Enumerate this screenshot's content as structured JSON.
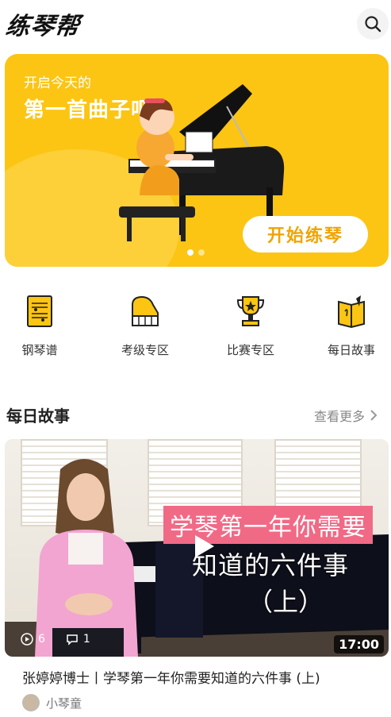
{
  "app": {
    "logo_text": "练琴帮"
  },
  "banner": {
    "subtitle": "开启今天的",
    "title": "第一首曲子吧",
    "cta_label": "开始练琴",
    "dot_count": 2,
    "active_dot": 0,
    "bg_color": "#fcc513"
  },
  "quick_nav": [
    {
      "label": "钢琴谱",
      "icon": "sheet-music-icon"
    },
    {
      "label": "考级专区",
      "icon": "piano-keys-icon"
    },
    {
      "label": "比赛专区",
      "icon": "trophy-icon"
    },
    {
      "label": "每日故事",
      "icon": "story-book-icon"
    }
  ],
  "stories": {
    "section_title": "每日故事",
    "more_label": "查看更多",
    "video": {
      "overlay_line1": "学琴第一年你需要",
      "overlay_line2": "知道的六件事",
      "overlay_line3": "（上）",
      "views": "6",
      "comments": "1",
      "duration": "17:00",
      "title": "张婷婷博士丨学琴第一年你需要知道的六件事 (上)",
      "author": "小琴童"
    }
  }
}
